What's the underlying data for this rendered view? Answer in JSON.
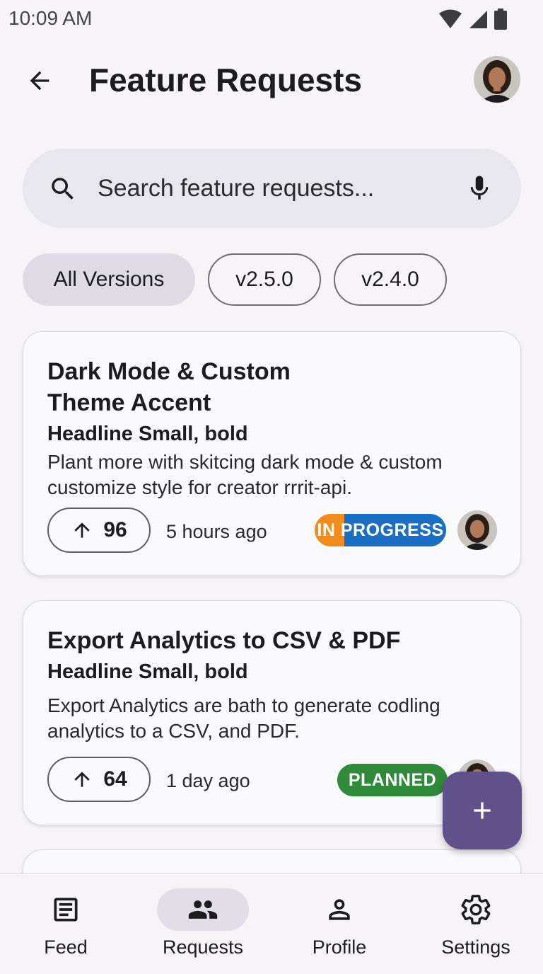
{
  "status_bar": {
    "time": "10:09 AM"
  },
  "header": {
    "title": "Feature Requests"
  },
  "search": {
    "placeholder": "Search feature requests..."
  },
  "chips": [
    {
      "label": "All Versions",
      "selected": true
    },
    {
      "label": "v2.5.0",
      "selected": false
    },
    {
      "label": "v2.4.0",
      "selected": false
    }
  ],
  "cards": [
    {
      "title": "Dark Mode & Custom Theme Accent",
      "subtitle": "Headline Small, bold",
      "description": "Plant more with skitcing dark mode & custom customize style for creator rrrit-api.",
      "votes": "96",
      "time": "5 hours ago",
      "status": "IN PROGRESS"
    },
    {
      "title": "Export Analytics to CSV & PDF",
      "subtitle": "Headline Small, bold",
      "description": "Export Analytics are bath to generate codling analytics to a CSV, and PDF.",
      "votes": "64",
      "time": "1 day ago",
      "status": "PLANNED"
    }
  ],
  "colors": {
    "in_progress_orange": "#f28c1c",
    "in_progress_blue": "#1a6fc4",
    "planned_green": "#2f8a3a",
    "fab": "#62508a",
    "active_nav": "#e1dde9"
  },
  "nav": [
    {
      "label": "Feed",
      "icon": "article-icon"
    },
    {
      "label": "Requests",
      "icon": "people-icon",
      "active": true
    },
    {
      "label": "Profile",
      "icon": "person-icon"
    },
    {
      "label": "Settings",
      "icon": "gear-icon"
    }
  ]
}
